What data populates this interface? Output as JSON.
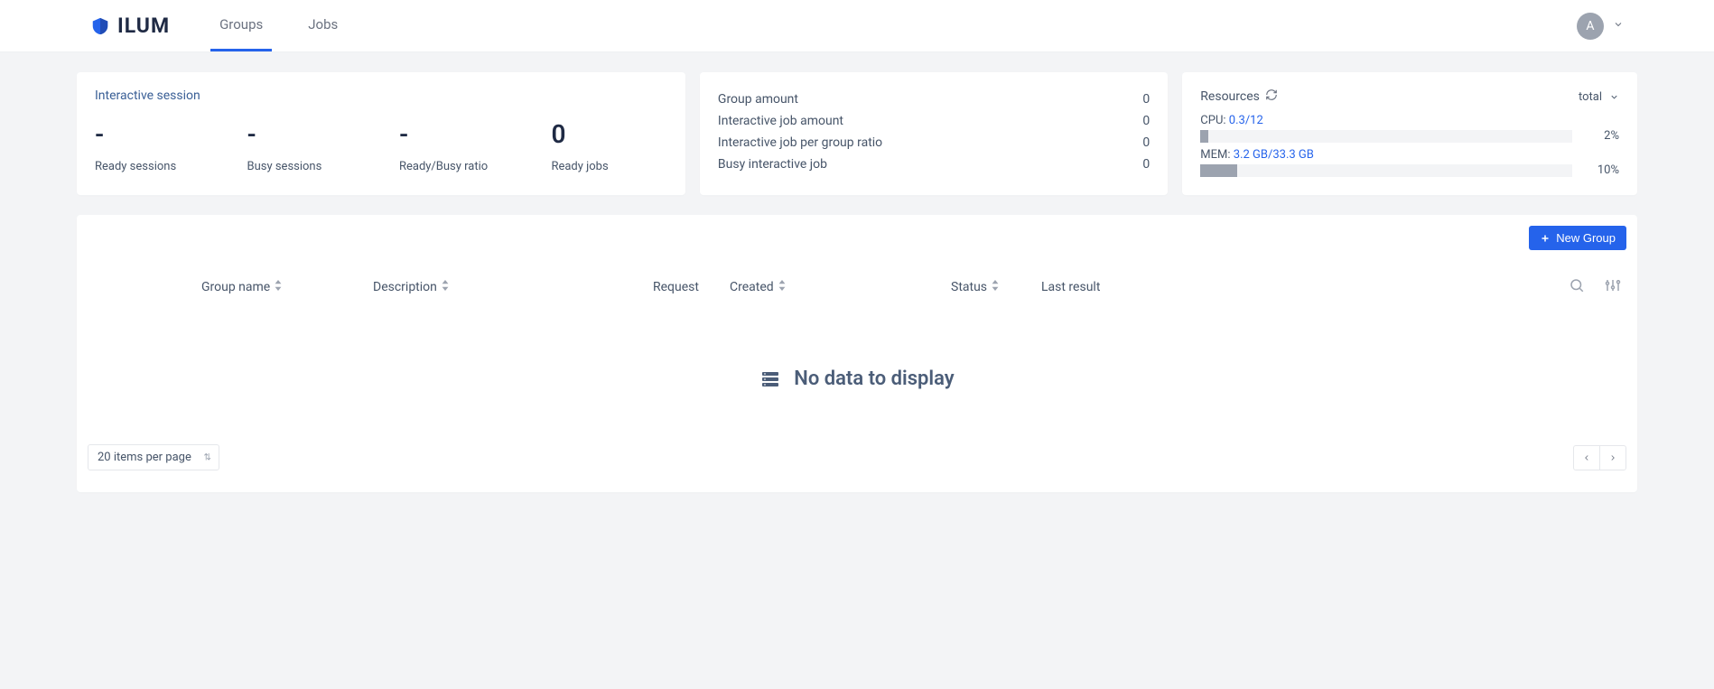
{
  "brand": {
    "name": "ILUM"
  },
  "nav": {
    "groups": "Groups",
    "jobs": "Jobs"
  },
  "user": {
    "initial": "A"
  },
  "session_card": {
    "title": "Interactive session",
    "ready_sessions": {
      "value": "-",
      "label": "Ready sessions"
    },
    "busy_sessions": {
      "value": "-",
      "label": "Busy sessions"
    },
    "ratio": {
      "value": "-",
      "label": "Ready/Busy ratio"
    },
    "ready_jobs": {
      "value": "0",
      "label": "Ready jobs"
    }
  },
  "group_metrics": {
    "group_amount": {
      "label": "Group amount",
      "value": "0"
    },
    "interactive_amount": {
      "label": "Interactive job amount",
      "value": "0"
    },
    "ratio": {
      "label": "Interactive job per group ratio",
      "value": "0"
    },
    "busy": {
      "label": "Busy interactive job",
      "value": "0"
    }
  },
  "resources": {
    "title": "Resources",
    "scope": "total",
    "cpu": {
      "label": "CPU:",
      "value": "0.3/12",
      "percent": "2%",
      "bar_pct": 2
    },
    "mem": {
      "label": "MEM:",
      "value": "3.2 GB/33.3 GB",
      "percent": "10%",
      "bar_pct": 10
    }
  },
  "table": {
    "new_group_btn": "New Group",
    "headers": {
      "group_name": "Group name",
      "description": "Description",
      "request": "Request",
      "created": "Created",
      "status": "Status",
      "last_result": "Last result"
    },
    "empty_message": "No data to display",
    "items_per_page": "20 items per page"
  }
}
